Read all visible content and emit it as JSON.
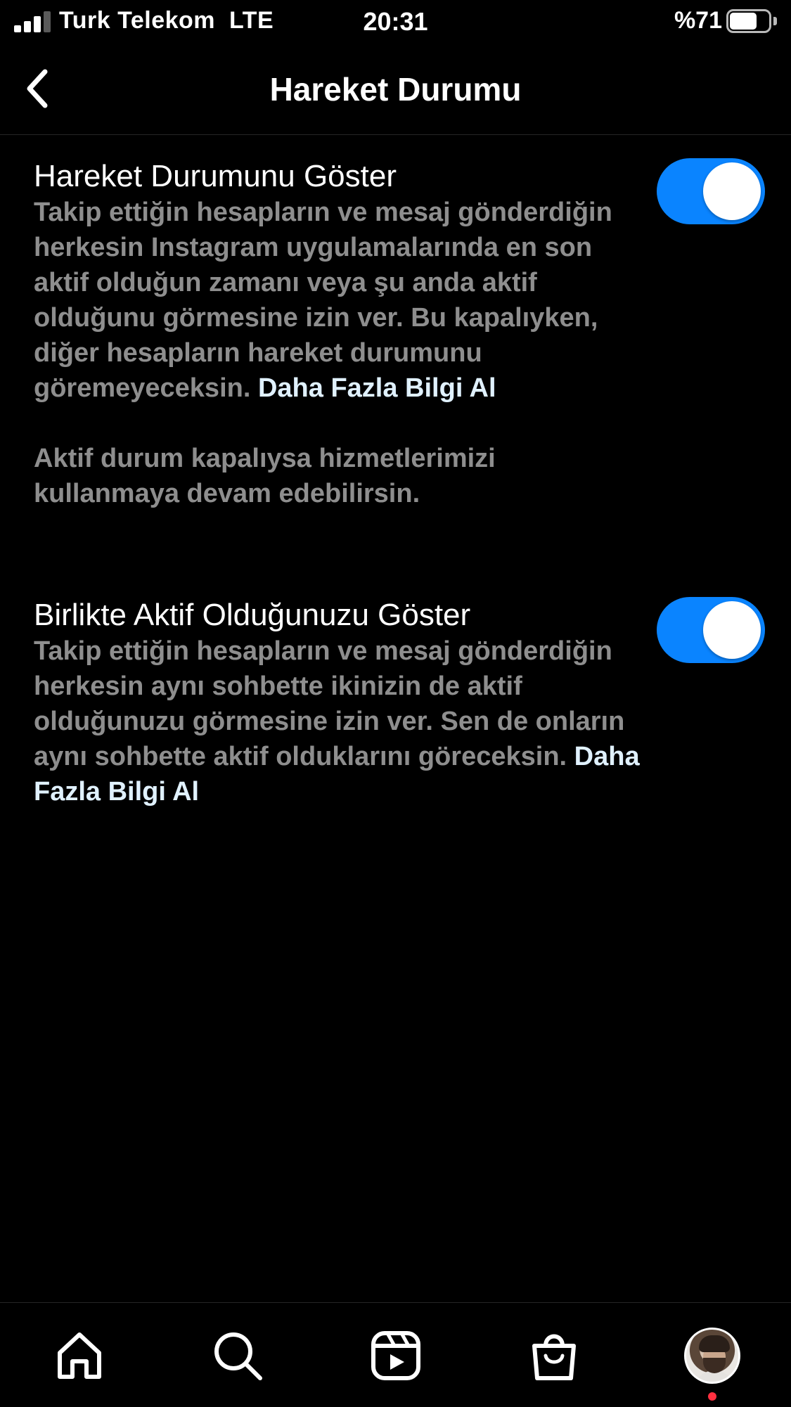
{
  "status_bar": {
    "carrier": "Turk Telekom",
    "network": "LTE",
    "time": "20:31",
    "battery_percent_label": "%71",
    "battery_level": 0.71,
    "signal_bars": 3
  },
  "header": {
    "title": "Hareket Durumu",
    "back_icon": "chevron-left-icon"
  },
  "settings": [
    {
      "title": "Hareket Durumunu Göster",
      "description": "Takip ettiğin hesapların ve mesaj gönderdiğin herkesin Instagram uygulamalarında en son aktif olduğun zamanı veya şu anda aktif olduğunu görmesine izin ver. Bu kapalıyken, diğer hesapların hareket durumunu göremeyeceksin.",
      "link": "Daha Fazla Bilgi Al",
      "note": "Aktif durum kapalıysa hizmetlerimizi kullanmaya devam edebilirsin.",
      "enabled": true
    },
    {
      "title": "Birlikte Aktif Olduğunuzu Göster",
      "description": "Takip ettiğin hesapların ve mesaj gönderdiğin herkesin aynı sohbette ikinizin de aktif olduğunuzu görmesine izin ver. Sen de onların aynı sohbette aktif olduklarını göreceksin.",
      "link": "Daha Fazla Bilgi Al",
      "enabled": true
    }
  ],
  "tab_bar": {
    "items": [
      "home-icon",
      "search-icon",
      "reels-icon",
      "shop-icon",
      "profile-avatar"
    ]
  },
  "colors": {
    "background": "#000000",
    "toggle_on": "#0a84ff",
    "secondary_text": "#8e8e8e",
    "link_text": "#e0f1ff",
    "notification_dot": "#ff3040"
  }
}
